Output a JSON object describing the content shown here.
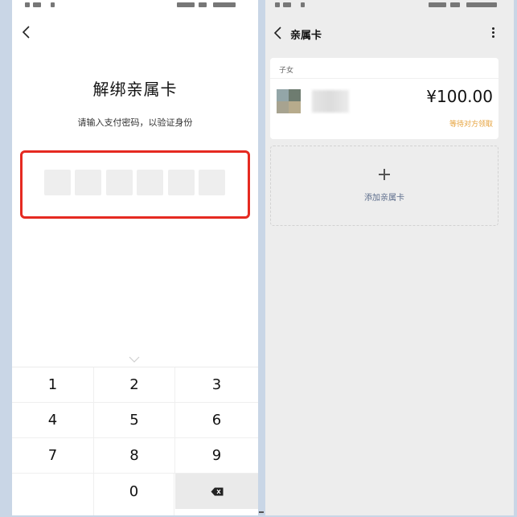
{
  "left_screen": {
    "title": "解绑亲属卡",
    "subtitle": "请输入支付密码，以验证身份",
    "pin_length": 6,
    "keypad": {
      "keys": [
        "1",
        "2",
        "3",
        "4",
        "5",
        "6",
        "7",
        "8",
        "9",
        "",
        "0"
      ],
      "delete_icon": "backspace-icon"
    },
    "highlight_color": "#e52a21"
  },
  "right_screen": {
    "title": "亲属卡",
    "card": {
      "relation": "子女",
      "amount": "¥100.00",
      "status": "等待对方领取",
      "status_color": "#e6a23c"
    },
    "add_card_label": "添加亲属卡"
  }
}
